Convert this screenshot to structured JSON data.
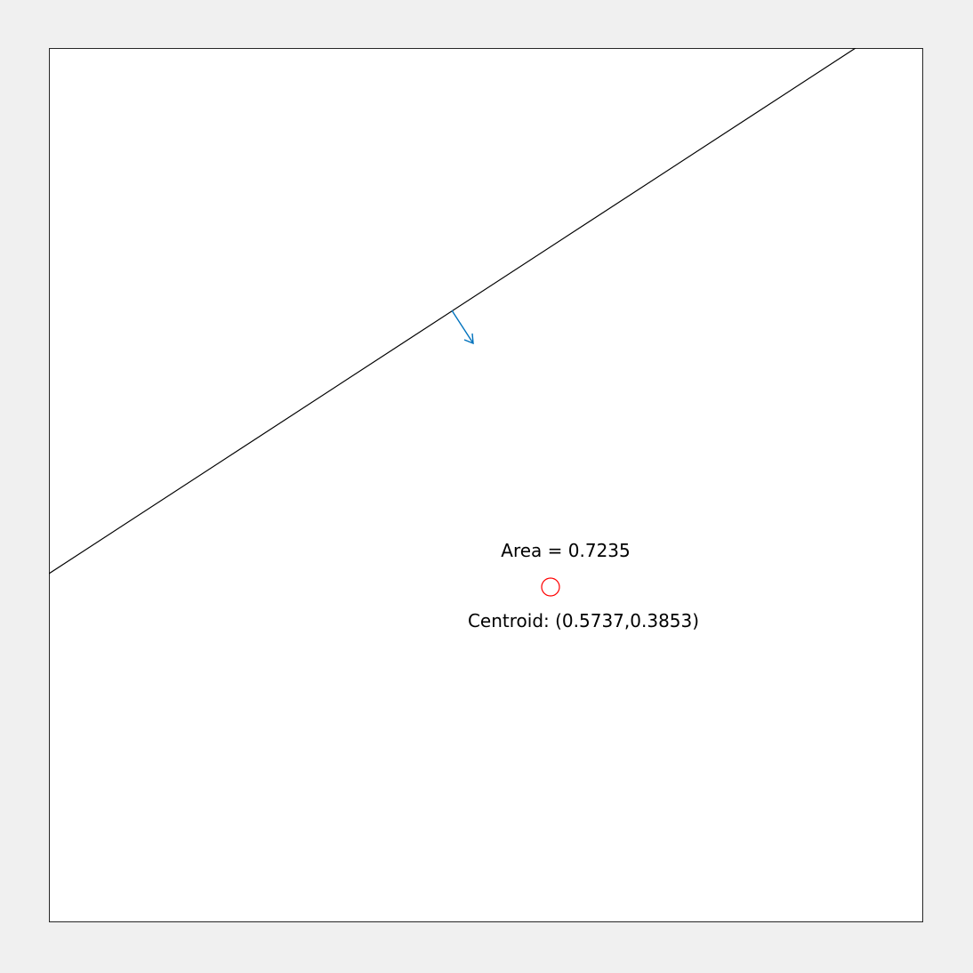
{
  "diagram": {
    "area_text": "Area = 0.7235",
    "centroid_text": "Centroid: (0.5737,0.3853)",
    "colors": {
      "figure_background": "#f0f0f0",
      "axes_background": "#ffffff",
      "line": "#000000",
      "normal_arrow": "#0072bd",
      "centroid_marker": "#ff0000"
    }
  }
}
